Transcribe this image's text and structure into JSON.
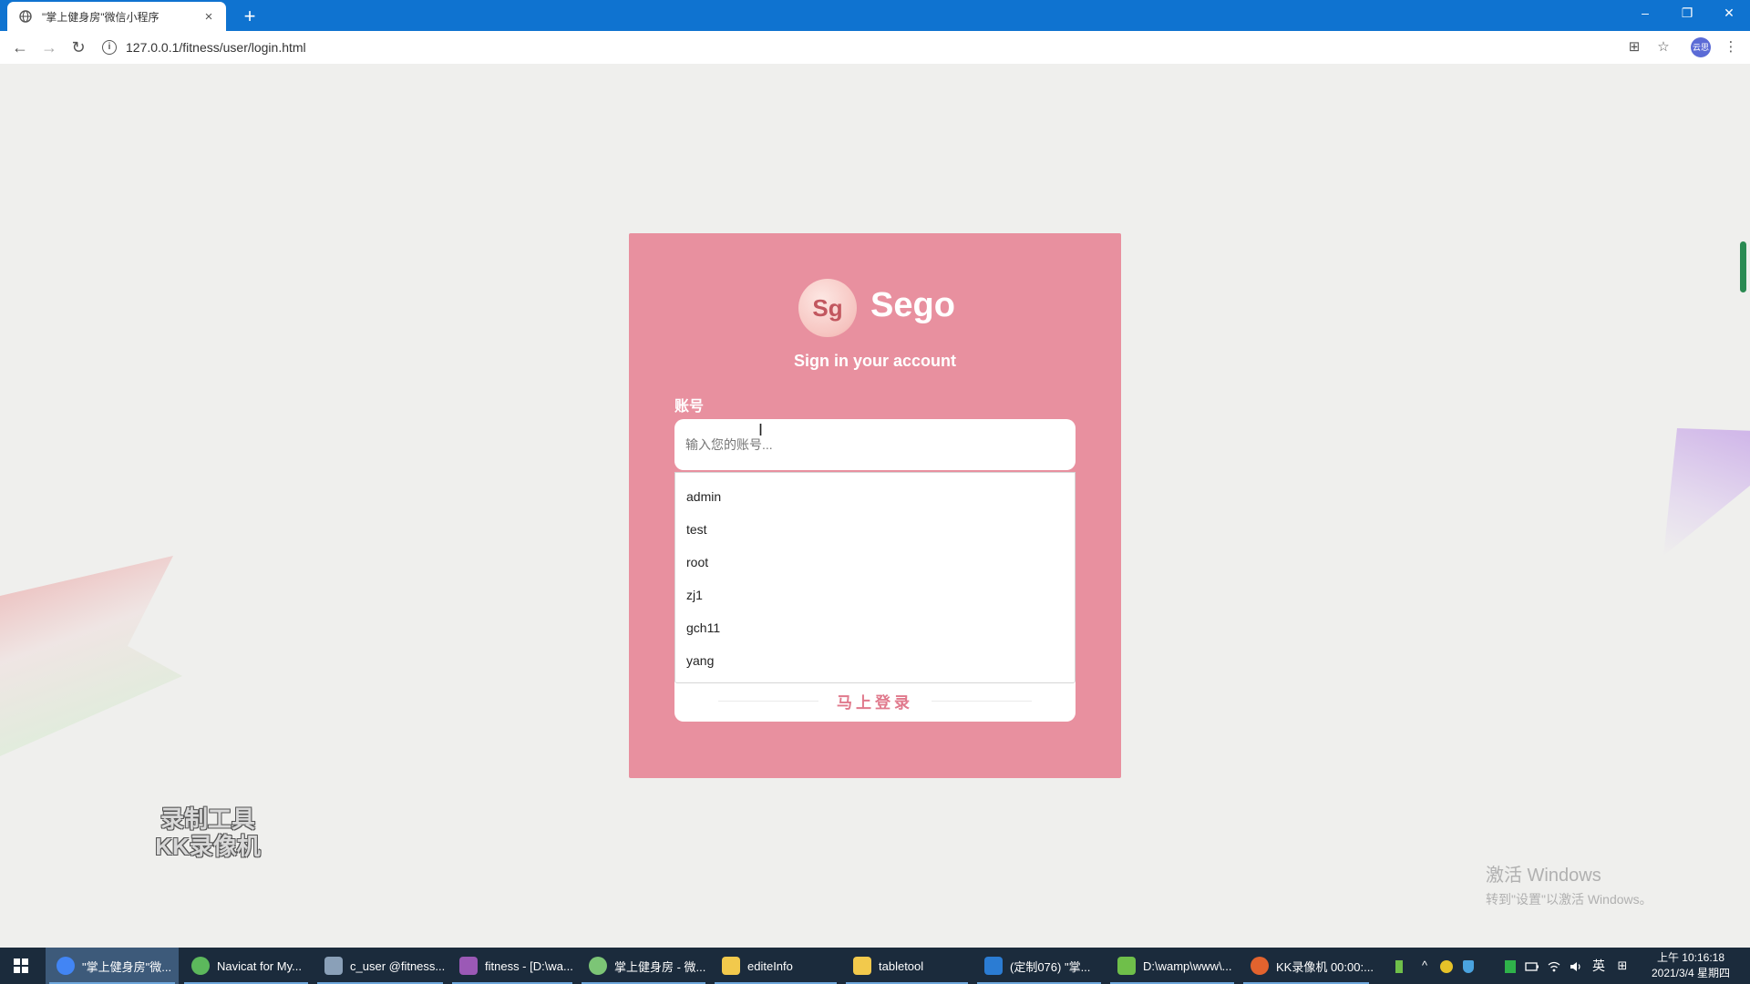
{
  "browser": {
    "tab_title": "\"掌上健身房\"微信小程序",
    "tab_close": "×",
    "new_tab": "+",
    "url": "127.0.0.1/fitness/user/login.html",
    "profile_badge": "云思",
    "window_controls": {
      "minimize": "–",
      "restore": "❐",
      "close": "✕"
    },
    "nav": {
      "back": "←",
      "forward": "→",
      "reload": "↻"
    },
    "toolbar_icons": {
      "translate": "⊞",
      "bookmark": "☆",
      "menu": "⋮"
    }
  },
  "login": {
    "logo_text": "Sg",
    "brand": "Sego",
    "subtitle": "Sign in your account",
    "account_label": "账号",
    "account_placeholder": "输入您的账号...",
    "autocomplete_options": [
      "admin",
      "test",
      "root",
      "zj1",
      "gch11",
      "yang"
    ],
    "submit_label": "马上登录",
    "accent_color": "#e8909f"
  },
  "overlay": {
    "recorder_watermark": [
      "录制工具",
      "KK录像机"
    ],
    "activate_title": "激活 Windows",
    "activate_hint": "转到\"设置\"以激活 Windows。"
  },
  "taskbar": {
    "items": [
      {
        "label": "\"掌上健身房\"微...",
        "color": "#4285f4",
        "active": true
      },
      {
        "label": "Navicat for My...",
        "color": "#5cb85c",
        "active": false
      },
      {
        "label": "c_user @fitness...",
        "color": "#8aa0b8",
        "active": false
      },
      {
        "label": "fitness - [D:\\wa...",
        "color": "#9b59b6",
        "active": false
      },
      {
        "label": "掌上健身房 - 微...",
        "color": "#7cc576",
        "active": false
      },
      {
        "label": "editeInfo",
        "color": "#f2c94c",
        "active": false
      },
      {
        "label": "tabletool",
        "color": "#f2c94c",
        "active": false
      },
      {
        "label": "(定制076) \"掌...",
        "color": "#2b7cd3",
        "active": false
      },
      {
        "label": "D:\\wamp\\www\\...",
        "color": "#6fbf4a",
        "active": false
      },
      {
        "label": "KK录像机 00:00:...",
        "color": "#e2632e",
        "active": false
      }
    ],
    "tray": {
      "caret": "^",
      "ime": "英",
      "keyboard": "⊞"
    },
    "clock_time": "上午 10:16:18",
    "clock_date": "2021/3/4 星期四"
  }
}
